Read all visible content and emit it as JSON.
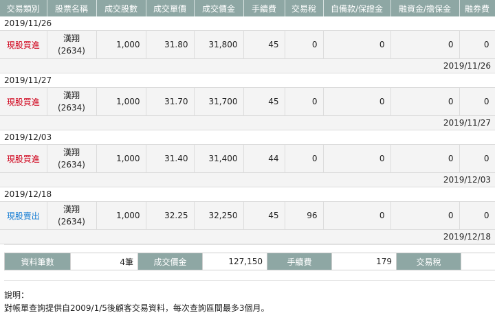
{
  "table": {
    "headers": [
      "交易類別",
      "股票名稱",
      "成交股數",
      "成交單價",
      "成交價金",
      "手續費",
      "交易稅",
      "自備款/保證金",
      "融資金/擔保金",
      "融券費",
      "…"
    ],
    "groups": [
      {
        "date": "2019/11/26",
        "type": "現股買進",
        "type_kind": "buy",
        "name": "漢翔",
        "code": "(2634)",
        "shares": "1,000",
        "price": "31.80",
        "amount": "31,800",
        "fee": "45",
        "tax": "0",
        "deposit": "0",
        "margin": "0",
        "short_fee": "0",
        "settle_date": "2019/11/26"
      },
      {
        "date": "2019/11/27",
        "type": "現股買進",
        "type_kind": "buy",
        "name": "漢翔",
        "code": "(2634)",
        "shares": "1,000",
        "price": "31.70",
        "amount": "31,700",
        "fee": "45",
        "tax": "0",
        "deposit": "0",
        "margin": "0",
        "short_fee": "0",
        "settle_date": "2019/11/27"
      },
      {
        "date": "2019/12/03",
        "type": "現股買進",
        "type_kind": "buy",
        "name": "漢翔",
        "code": "(2634)",
        "shares": "1,000",
        "price": "31.40",
        "amount": "31,400",
        "fee": "44",
        "tax": "0",
        "deposit": "0",
        "margin": "0",
        "short_fee": "0",
        "settle_date": "2019/12/03"
      },
      {
        "date": "2019/12/18",
        "type": "現股賣出",
        "type_kind": "sell",
        "name": "漢翔",
        "code": "(2634)",
        "shares": "1,000",
        "price": "32.25",
        "amount": "32,250",
        "fee": "45",
        "tax": "96",
        "deposit": "0",
        "margin": "0",
        "short_fee": "0",
        "settle_date": "2019/12/18"
      }
    ]
  },
  "summary": {
    "count_label": "資料筆數",
    "count_value": "4筆",
    "amount_label": "成交價金",
    "amount_value": "127,150",
    "fee_label": "手續費",
    "fee_value": "179",
    "tax_label": "交易稅",
    "tax_value": ""
  },
  "note": {
    "title": "說明：",
    "text": "對帳單查詢提供自2009/1/5後顧客交易資料，每次查詢區間最多3個月。"
  },
  "colors": {
    "header_bg": "#8ea7a4",
    "buy": "#d0021b",
    "sell": "#1a7fd4"
  }
}
